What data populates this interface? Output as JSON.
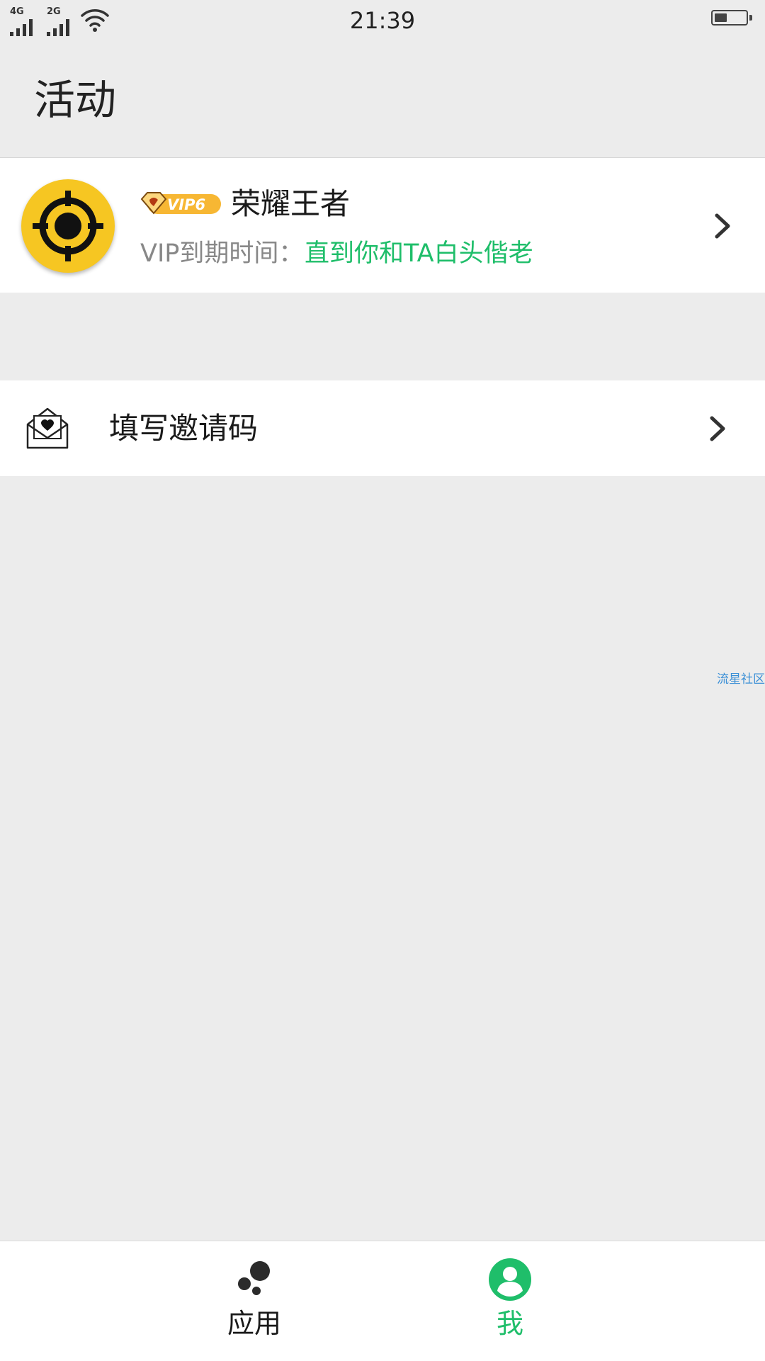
{
  "status_bar": {
    "network_1": "4G",
    "network_2": "2G",
    "time": "21:39",
    "battery_level": 0.4
  },
  "header": {
    "title": "活动"
  },
  "profile": {
    "avatar_icon": "target-crosshair-icon",
    "vip_badge": "VIP6",
    "name": "荣耀王者",
    "vip_expiry_label": "VIP到期时间：",
    "vip_expiry_value": "直到你和TA白头偕老"
  },
  "invite": {
    "label": "填写邀请码",
    "icon": "envelope-heart-icon"
  },
  "watermark": "流星社区",
  "tabs": [
    {
      "label": "应用",
      "icon": "apps-dots-icon",
      "active": false
    },
    {
      "label": "我",
      "icon": "user-profile-icon",
      "active": true
    }
  ],
  "colors": {
    "accent_green": "#1fbe6a",
    "avatar_yellow": "#f6c622",
    "background": "#ececec"
  }
}
